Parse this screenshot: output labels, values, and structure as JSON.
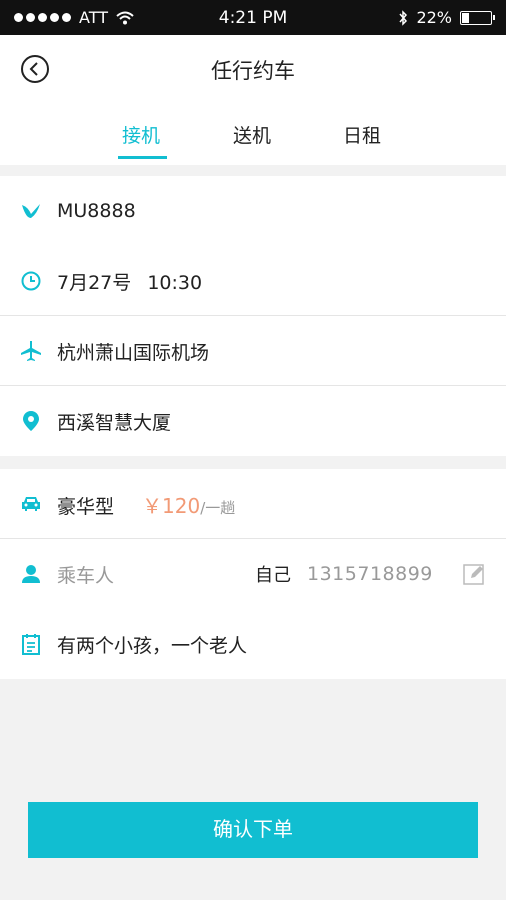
{
  "status_bar": {
    "carrier": "ATT",
    "time": "4:21 PM",
    "battery": "22%"
  },
  "header": {
    "title": "任行约车"
  },
  "tabs": [
    {
      "label": "接机",
      "active": true
    },
    {
      "label": "送机",
      "active": false
    },
    {
      "label": "日租",
      "active": false
    }
  ],
  "trip": {
    "flight_no": "MU8888",
    "date": "7月27号",
    "time": "10:30",
    "from": "杭州萧山国际机场",
    "to": "西溪智慧大厦"
  },
  "order": {
    "car_type": "豪华型",
    "price": "￥120",
    "price_unit": "/一趟",
    "passenger_label": "乘车人",
    "passenger_name": "自己",
    "passenger_phone": "1315718899",
    "note": "有两个小孩，一个老人"
  },
  "confirm_button": "确认下单",
  "colors": {
    "accent": "#11bed1",
    "price": "#f29a76",
    "background": "#f2f2f2"
  }
}
